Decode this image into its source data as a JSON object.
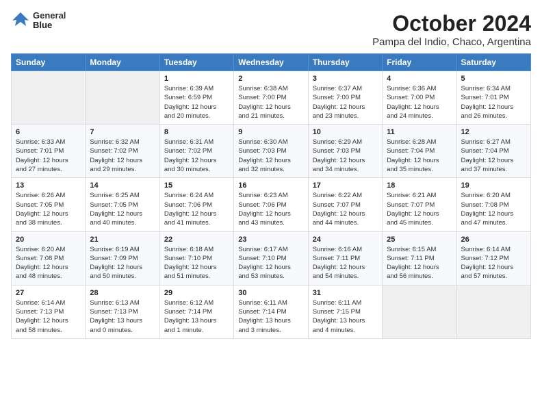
{
  "logo": {
    "line1": "General",
    "line2": "Blue"
  },
  "title": "October 2024",
  "subtitle": "Pampa del Indio, Chaco, Argentina",
  "days_of_week": [
    "Sunday",
    "Monday",
    "Tuesday",
    "Wednesday",
    "Thursday",
    "Friday",
    "Saturday"
  ],
  "weeks": [
    [
      {
        "day": "",
        "info": ""
      },
      {
        "day": "",
        "info": ""
      },
      {
        "day": "1",
        "info": "Sunrise: 6:39 AM\nSunset: 6:59 PM\nDaylight: 12 hours\nand 20 minutes."
      },
      {
        "day": "2",
        "info": "Sunrise: 6:38 AM\nSunset: 7:00 PM\nDaylight: 12 hours\nand 21 minutes."
      },
      {
        "day": "3",
        "info": "Sunrise: 6:37 AM\nSunset: 7:00 PM\nDaylight: 12 hours\nand 23 minutes."
      },
      {
        "day": "4",
        "info": "Sunrise: 6:36 AM\nSunset: 7:00 PM\nDaylight: 12 hours\nand 24 minutes."
      },
      {
        "day": "5",
        "info": "Sunrise: 6:34 AM\nSunset: 7:01 PM\nDaylight: 12 hours\nand 26 minutes."
      }
    ],
    [
      {
        "day": "6",
        "info": "Sunrise: 6:33 AM\nSunset: 7:01 PM\nDaylight: 12 hours\nand 27 minutes."
      },
      {
        "day": "7",
        "info": "Sunrise: 6:32 AM\nSunset: 7:02 PM\nDaylight: 12 hours\nand 29 minutes."
      },
      {
        "day": "8",
        "info": "Sunrise: 6:31 AM\nSunset: 7:02 PM\nDaylight: 12 hours\nand 30 minutes."
      },
      {
        "day": "9",
        "info": "Sunrise: 6:30 AM\nSunset: 7:03 PM\nDaylight: 12 hours\nand 32 minutes."
      },
      {
        "day": "10",
        "info": "Sunrise: 6:29 AM\nSunset: 7:03 PM\nDaylight: 12 hours\nand 34 minutes."
      },
      {
        "day": "11",
        "info": "Sunrise: 6:28 AM\nSunset: 7:04 PM\nDaylight: 12 hours\nand 35 minutes."
      },
      {
        "day": "12",
        "info": "Sunrise: 6:27 AM\nSunset: 7:04 PM\nDaylight: 12 hours\nand 37 minutes."
      }
    ],
    [
      {
        "day": "13",
        "info": "Sunrise: 6:26 AM\nSunset: 7:05 PM\nDaylight: 12 hours\nand 38 minutes."
      },
      {
        "day": "14",
        "info": "Sunrise: 6:25 AM\nSunset: 7:05 PM\nDaylight: 12 hours\nand 40 minutes."
      },
      {
        "day": "15",
        "info": "Sunrise: 6:24 AM\nSunset: 7:06 PM\nDaylight: 12 hours\nand 41 minutes."
      },
      {
        "day": "16",
        "info": "Sunrise: 6:23 AM\nSunset: 7:06 PM\nDaylight: 12 hours\nand 43 minutes."
      },
      {
        "day": "17",
        "info": "Sunrise: 6:22 AM\nSunset: 7:07 PM\nDaylight: 12 hours\nand 44 minutes."
      },
      {
        "day": "18",
        "info": "Sunrise: 6:21 AM\nSunset: 7:07 PM\nDaylight: 12 hours\nand 45 minutes."
      },
      {
        "day": "19",
        "info": "Sunrise: 6:20 AM\nSunset: 7:08 PM\nDaylight: 12 hours\nand 47 minutes."
      }
    ],
    [
      {
        "day": "20",
        "info": "Sunrise: 6:20 AM\nSunset: 7:08 PM\nDaylight: 12 hours\nand 48 minutes."
      },
      {
        "day": "21",
        "info": "Sunrise: 6:19 AM\nSunset: 7:09 PM\nDaylight: 12 hours\nand 50 minutes."
      },
      {
        "day": "22",
        "info": "Sunrise: 6:18 AM\nSunset: 7:10 PM\nDaylight: 12 hours\nand 51 minutes."
      },
      {
        "day": "23",
        "info": "Sunrise: 6:17 AM\nSunset: 7:10 PM\nDaylight: 12 hours\nand 53 minutes."
      },
      {
        "day": "24",
        "info": "Sunrise: 6:16 AM\nSunset: 7:11 PM\nDaylight: 12 hours\nand 54 minutes."
      },
      {
        "day": "25",
        "info": "Sunrise: 6:15 AM\nSunset: 7:11 PM\nDaylight: 12 hours\nand 56 minutes."
      },
      {
        "day": "26",
        "info": "Sunrise: 6:14 AM\nSunset: 7:12 PM\nDaylight: 12 hours\nand 57 minutes."
      }
    ],
    [
      {
        "day": "27",
        "info": "Sunrise: 6:14 AM\nSunset: 7:13 PM\nDaylight: 12 hours\nand 58 minutes."
      },
      {
        "day": "28",
        "info": "Sunrise: 6:13 AM\nSunset: 7:13 PM\nDaylight: 13 hours\nand 0 minutes."
      },
      {
        "day": "29",
        "info": "Sunrise: 6:12 AM\nSunset: 7:14 PM\nDaylight: 13 hours\nand 1 minute."
      },
      {
        "day": "30",
        "info": "Sunrise: 6:11 AM\nSunset: 7:14 PM\nDaylight: 13 hours\nand 3 minutes."
      },
      {
        "day": "31",
        "info": "Sunrise: 6:11 AM\nSunset: 7:15 PM\nDaylight: 13 hours\nand 4 minutes."
      },
      {
        "day": "",
        "info": ""
      },
      {
        "day": "",
        "info": ""
      }
    ]
  ]
}
